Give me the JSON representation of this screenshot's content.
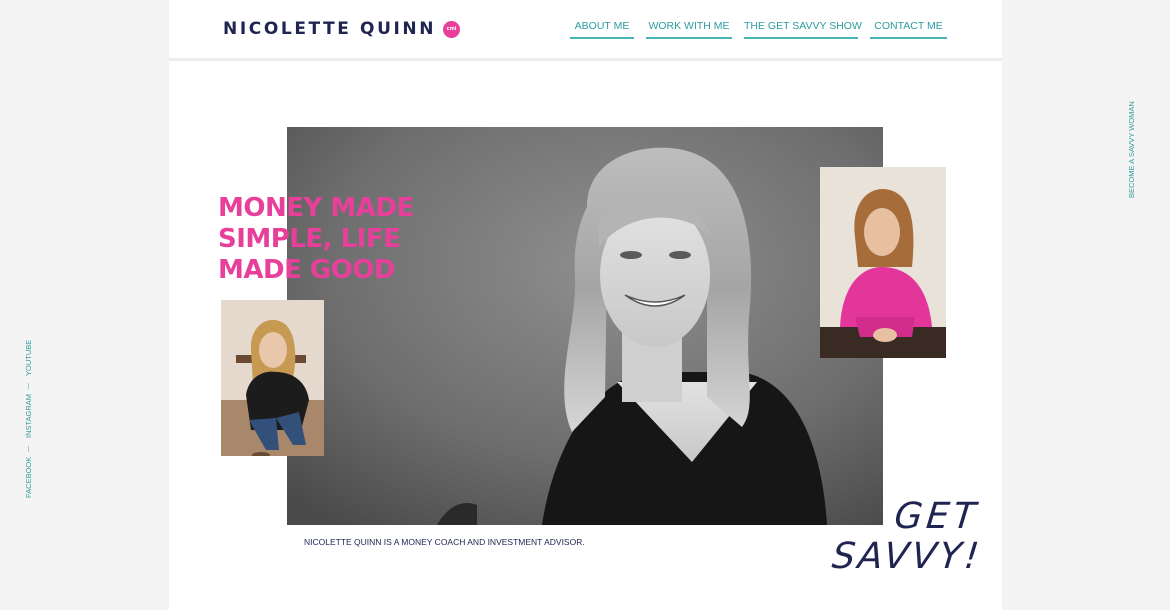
{
  "brand": {
    "name": "NICOLETTE QUINN",
    "badge": "cmi",
    "color_navy": "#1f2451",
    "color_pink": "#e8409a",
    "color_teal": "#2d9ba0"
  },
  "nav": {
    "items": [
      {
        "label": "ABOUT ME"
      },
      {
        "label": "WORK WITH ME"
      },
      {
        "label": "THE GET SAVVY SHOW"
      },
      {
        "label": "CONTACT ME"
      }
    ]
  },
  "hero": {
    "headline_lines": [
      "MONEY MADE",
      "SIMPLE, LIFE",
      "MADE GOOD"
    ],
    "caption": "NICOLETTE QUINN IS A MONEY COACH AND INVESTMENT ADVISOR.",
    "script_line1": "GET",
    "script_line2": "SAVVY!"
  },
  "side": {
    "cta": "BECOME A SAVVY WOMAN",
    "social": [
      {
        "label": "YOUTUBE"
      },
      {
        "label": "INSTAGRAM"
      },
      {
        "label": "FACEBOOK"
      }
    ]
  }
}
